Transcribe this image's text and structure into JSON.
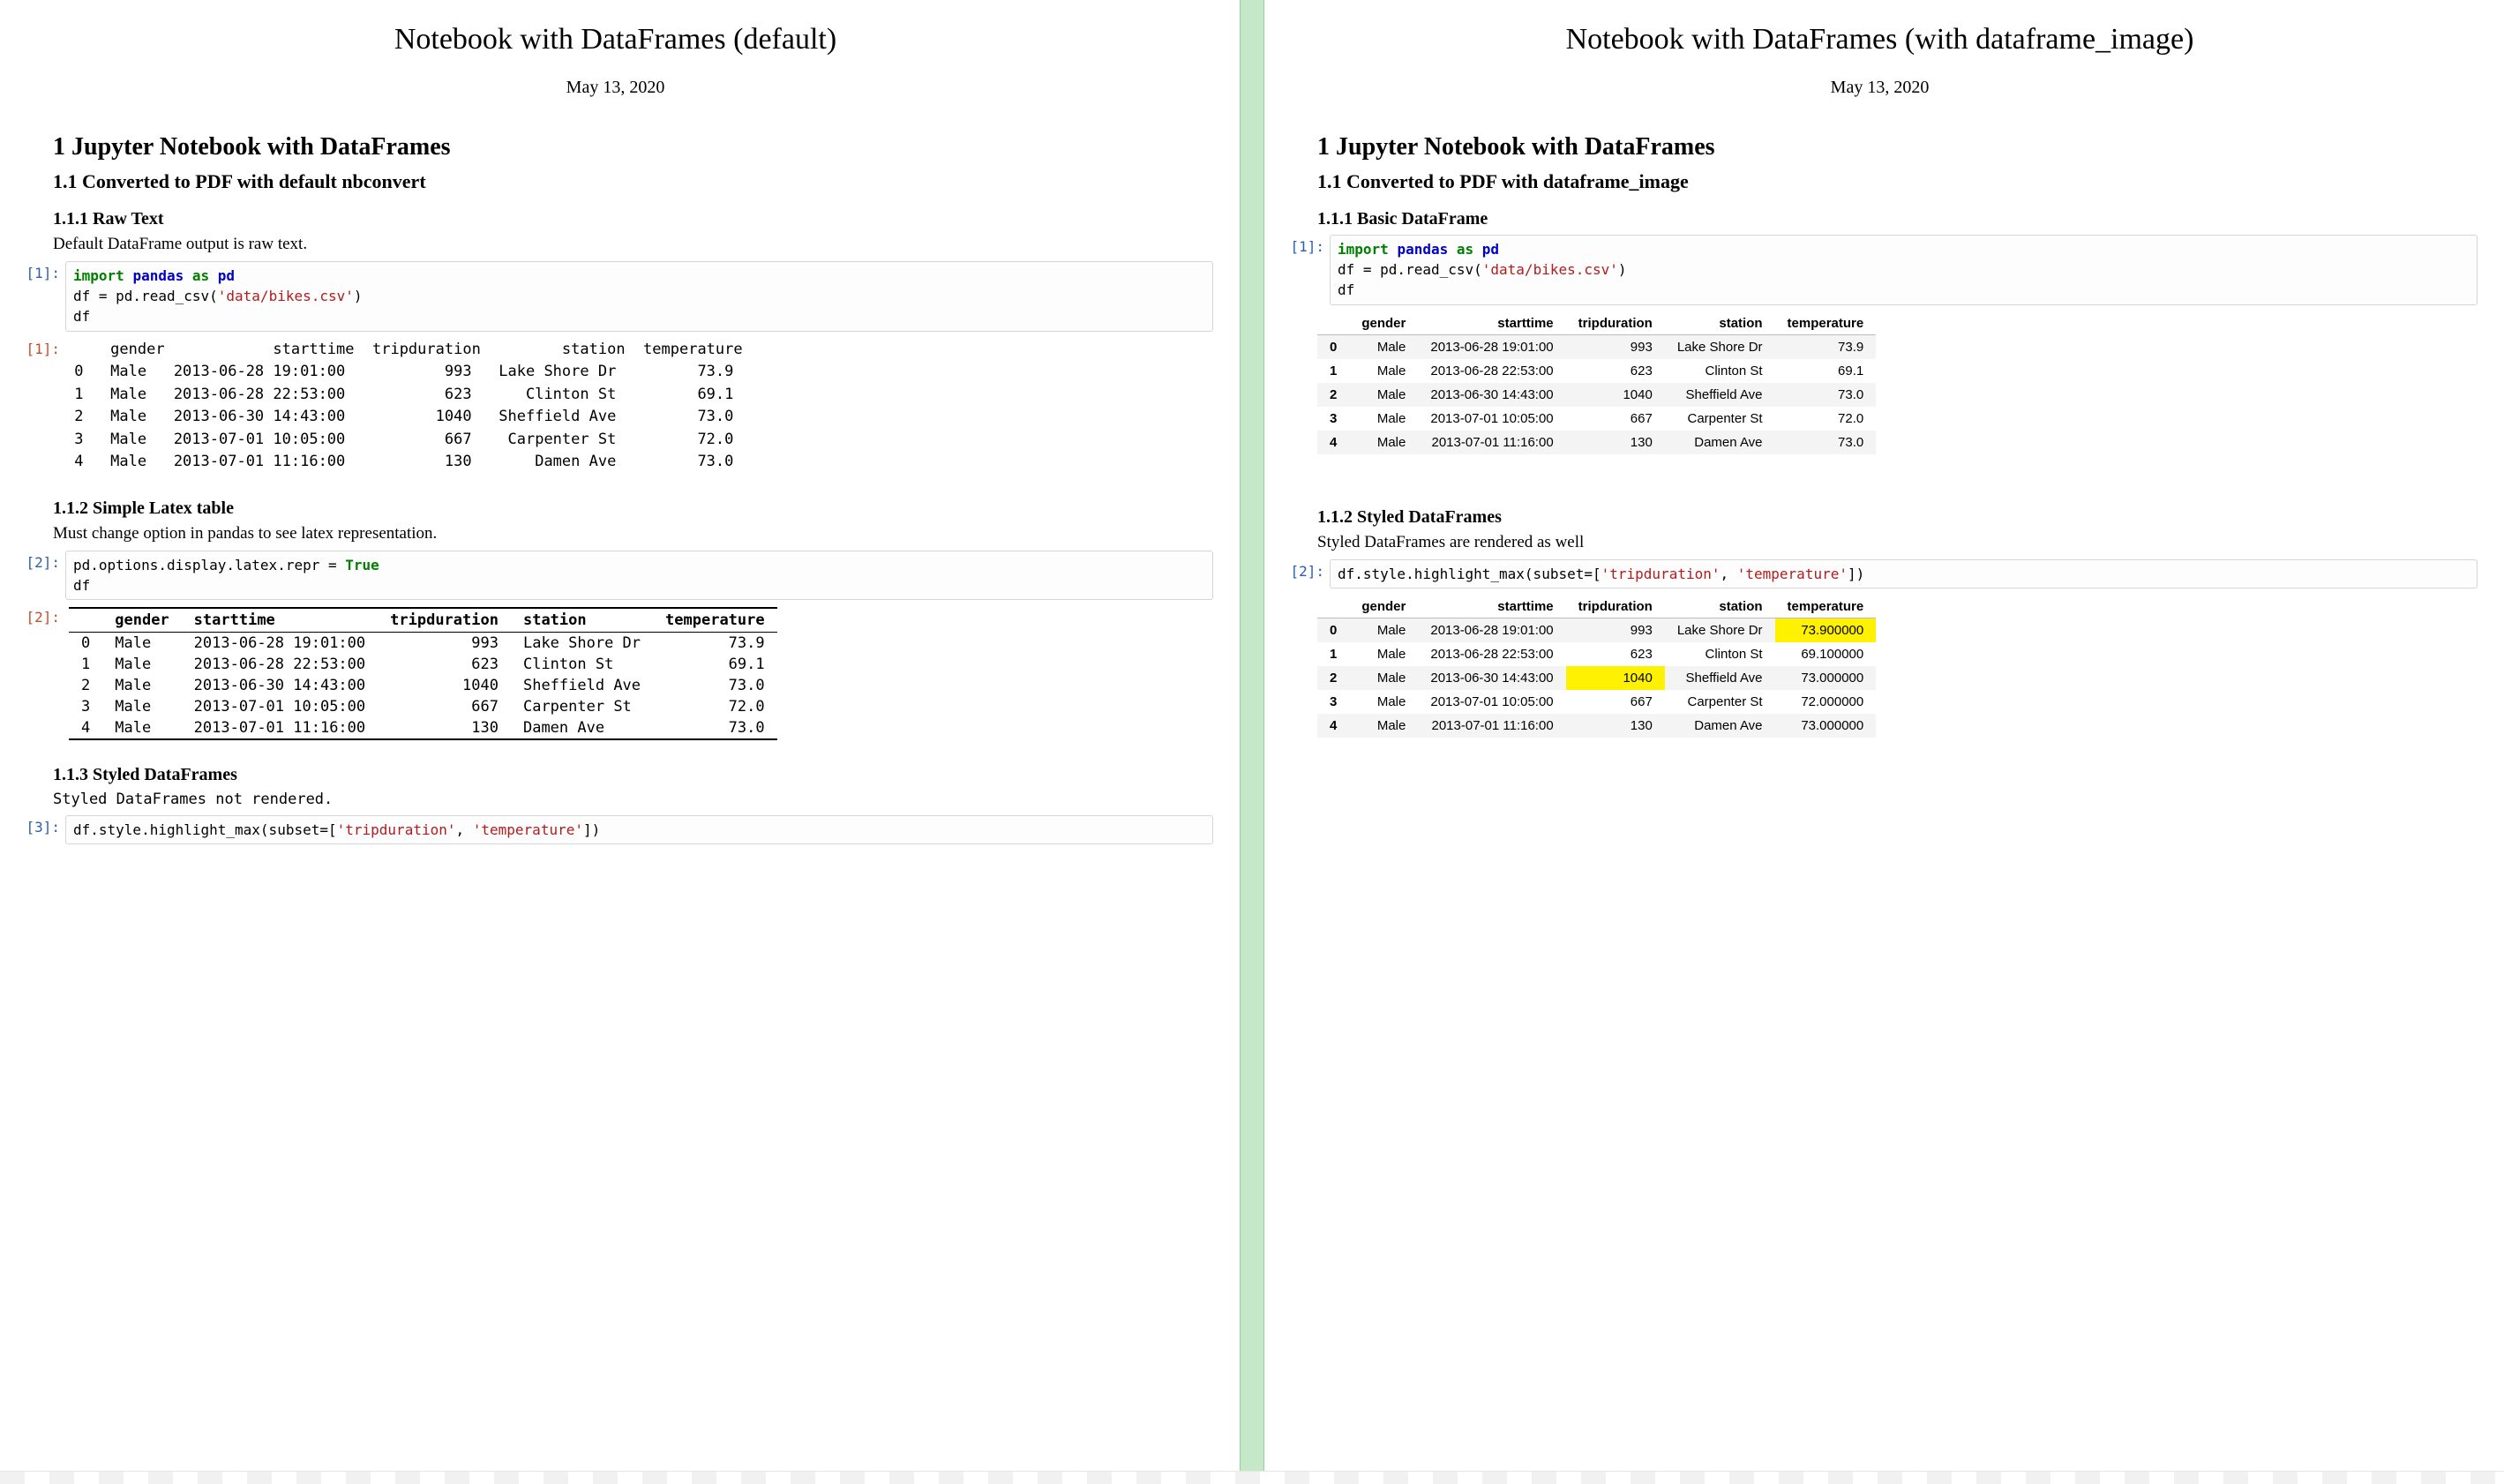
{
  "date": "May 13, 2020",
  "columns": [
    "gender",
    "starttime",
    "tripduration",
    "station",
    "temperature"
  ],
  "rows": [
    {
      "idx": "0",
      "gender": "Male",
      "starttime": "2013-06-28 19:01:00",
      "tripduration": "993",
      "station": "Lake Shore Dr",
      "temperature": "73.9"
    },
    {
      "idx": "1",
      "gender": "Male",
      "starttime": "2013-06-28 22:53:00",
      "tripduration": "623",
      "station": "Clinton St",
      "temperature": "69.1"
    },
    {
      "idx": "2",
      "gender": "Male",
      "starttime": "2013-06-30 14:43:00",
      "tripduration": "1040",
      "station": "Sheffield Ave",
      "temperature": "73.0"
    },
    {
      "idx": "3",
      "gender": "Male",
      "starttime": "2013-07-01 10:05:00",
      "tripduration": "667",
      "station": "Carpenter St",
      "temperature": "72.0"
    },
    {
      "idx": "4",
      "gender": "Male",
      "starttime": "2013-07-01 11:16:00",
      "tripduration": "130",
      "station": "Damen Ave",
      "temperature": "73.0"
    }
  ],
  "styled_rows": [
    {
      "idx": "0",
      "gender": "Male",
      "starttime": "2013-06-28 19:01:00",
      "tripduration": "993",
      "station": "Lake Shore Dr",
      "temperature": "73.900000",
      "hl_trip": false,
      "hl_temp": true
    },
    {
      "idx": "1",
      "gender": "Male",
      "starttime": "2013-06-28 22:53:00",
      "tripduration": "623",
      "station": "Clinton St",
      "temperature": "69.100000",
      "hl_trip": false,
      "hl_temp": false
    },
    {
      "idx": "2",
      "gender": "Male",
      "starttime": "2013-06-30 14:43:00",
      "tripduration": "1040",
      "station": "Sheffield Ave",
      "temperature": "73.000000",
      "hl_trip": true,
      "hl_temp": false
    },
    {
      "idx": "3",
      "gender": "Male",
      "starttime": "2013-07-01 10:05:00",
      "tripduration": "667",
      "station": "Carpenter St",
      "temperature": "72.000000",
      "hl_trip": false,
      "hl_temp": false
    },
    {
      "idx": "4",
      "gender": "Male",
      "starttime": "2013-07-01 11:16:00",
      "tripduration": "130",
      "station": "Damen Ave",
      "temperature": "73.000000",
      "hl_trip": false,
      "hl_temp": false
    }
  ],
  "left": {
    "title": "Notebook with DataFrames (default)",
    "h1": "1   Jupyter Notebook with DataFrames",
    "h2": "1.1   Converted to PDF with default nbconvert",
    "s1_h": "1.1.1   Raw Text",
    "s1_p": "Default DataFrame output is raw text.",
    "prompt_in1": "[1]:",
    "prompt_out1": "[1]:",
    "code1_html": "<span class='tok-kw'>import</span> <span class='tok-mod'>pandas</span> <span class='tok-kw'>as</span> <span class='tok-mod'>pd</span>\ndf = pd.read_csv(<span class='tok-str'>'data/bikes.csv'</span>)\ndf",
    "raw_out_header": "     gender            starttime  tripduration         station  temperature",
    "s2_h": "1.1.2   Simple Latex table",
    "s2_p": "Must change option in pandas to see latex representation.",
    "prompt_in2": "[2]:",
    "prompt_out2": "[2]:",
    "code2_html": "pd.options.display.latex.repr = <span class='tok-bool'>True</span>\ndf",
    "s3_h": "1.1.3   Styled DataFrames",
    "s3_p": "Styled DataFrames not rendered.",
    "prompt_in3": "[3]:",
    "code3_html": "df.style.highlight_max(subset=[<span class='tok-str'>'tripduration'</span>, <span class='tok-str'>'temperature'</span>])"
  },
  "right": {
    "title": "Notebook with DataFrames (with dataframe_image)",
    "h1": "1   Jupyter Notebook with DataFrames",
    "h2": "1.1   Converted to PDF with dataframe_image",
    "s1_h": "1.1.1   Basic DataFrame",
    "prompt_in1": "[1]:",
    "code1_html": "<span class='tok-kw'>import</span> <span class='tok-mod'>pandas</span> <span class='tok-kw'>as</span> <span class='tok-mod'>pd</span>\ndf = pd.read_csv(<span class='tok-str'>'data/bikes.csv'</span>)\ndf",
    "s2_h": "1.1.2   Styled DataFrames",
    "s2_p": "Styled DataFrames are rendered as well",
    "prompt_in2": "[2]:",
    "code2_html": "df.style.highlight_max(subset=[<span class='tok-str'>'tripduration'</span>, <span class='tok-str'>'temperature'</span>])"
  }
}
